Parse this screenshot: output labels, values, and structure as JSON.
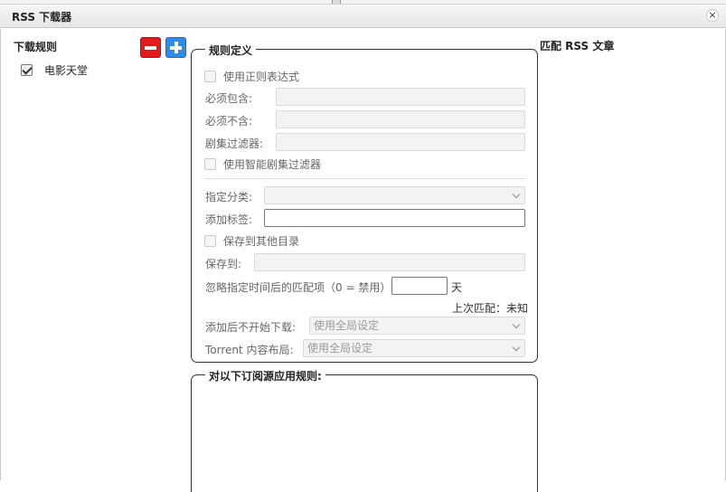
{
  "dialog": {
    "title": "RSS 下载器",
    "close_glyph": "×"
  },
  "sidebar": {
    "heading": "下载规则",
    "rules": [
      {
        "label": "电影天堂",
        "checked": true
      }
    ]
  },
  "rule_def": {
    "legend": "规则定义",
    "use_regex": "使用正则表达式",
    "must_contain": "必须包含:",
    "must_not_contain": "必须不含:",
    "episode_filter": "剧集过滤器:",
    "smart_episode_filter": "使用智能剧集过滤器",
    "category": "指定分类:",
    "add_tags": "添加标签:",
    "save_other_dir": "保存到其他目录",
    "save_to": "保存到:",
    "ignore_days": "忽略指定时间后的匹配项（0 = 禁用）",
    "days_unit": "天",
    "last_match": "上次匹配：未知",
    "add_paused": "添加后不开始下载:",
    "add_paused_value": "使用全局设定",
    "content_layout": "Torrent 内容布局:",
    "content_layout_value": "使用全局设定"
  },
  "feeds": {
    "legend": "对以下订阅源应用规则:"
  },
  "matches": {
    "heading": "匹配 RSS 文章"
  }
}
